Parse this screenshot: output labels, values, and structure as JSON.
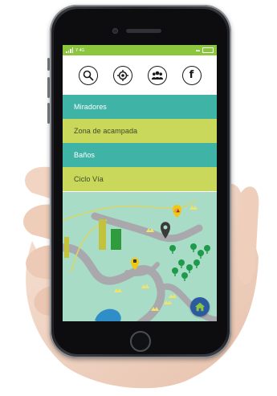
{
  "status_bar": {
    "carrier": "Y 4G",
    "battery_label": "▬"
  },
  "toolbar": {
    "icons": [
      "search-icon",
      "location-target-icon",
      "community-icon",
      "facebook-icon"
    ],
    "facebook_glyph": "f"
  },
  "menu": {
    "items": [
      {
        "label": "Miradores",
        "color": "#3fb3a6"
      },
      {
        "label": "Zona de acampada",
        "color": "#c9d85a"
      },
      {
        "label": "Baños",
        "color": "#3fb3a6"
      },
      {
        "label": "Ciclo Vía",
        "color": "#c9d85a"
      }
    ]
  },
  "map": {
    "background": "#a8dcc7",
    "road_color": "#a9a9ad",
    "marker_color": "#f2c80f",
    "pin_color": "#3a3a3a",
    "tree_color": "#1e9a4a"
  },
  "home_button": {
    "icon": "home-icon",
    "color": "#2c5aa0"
  }
}
